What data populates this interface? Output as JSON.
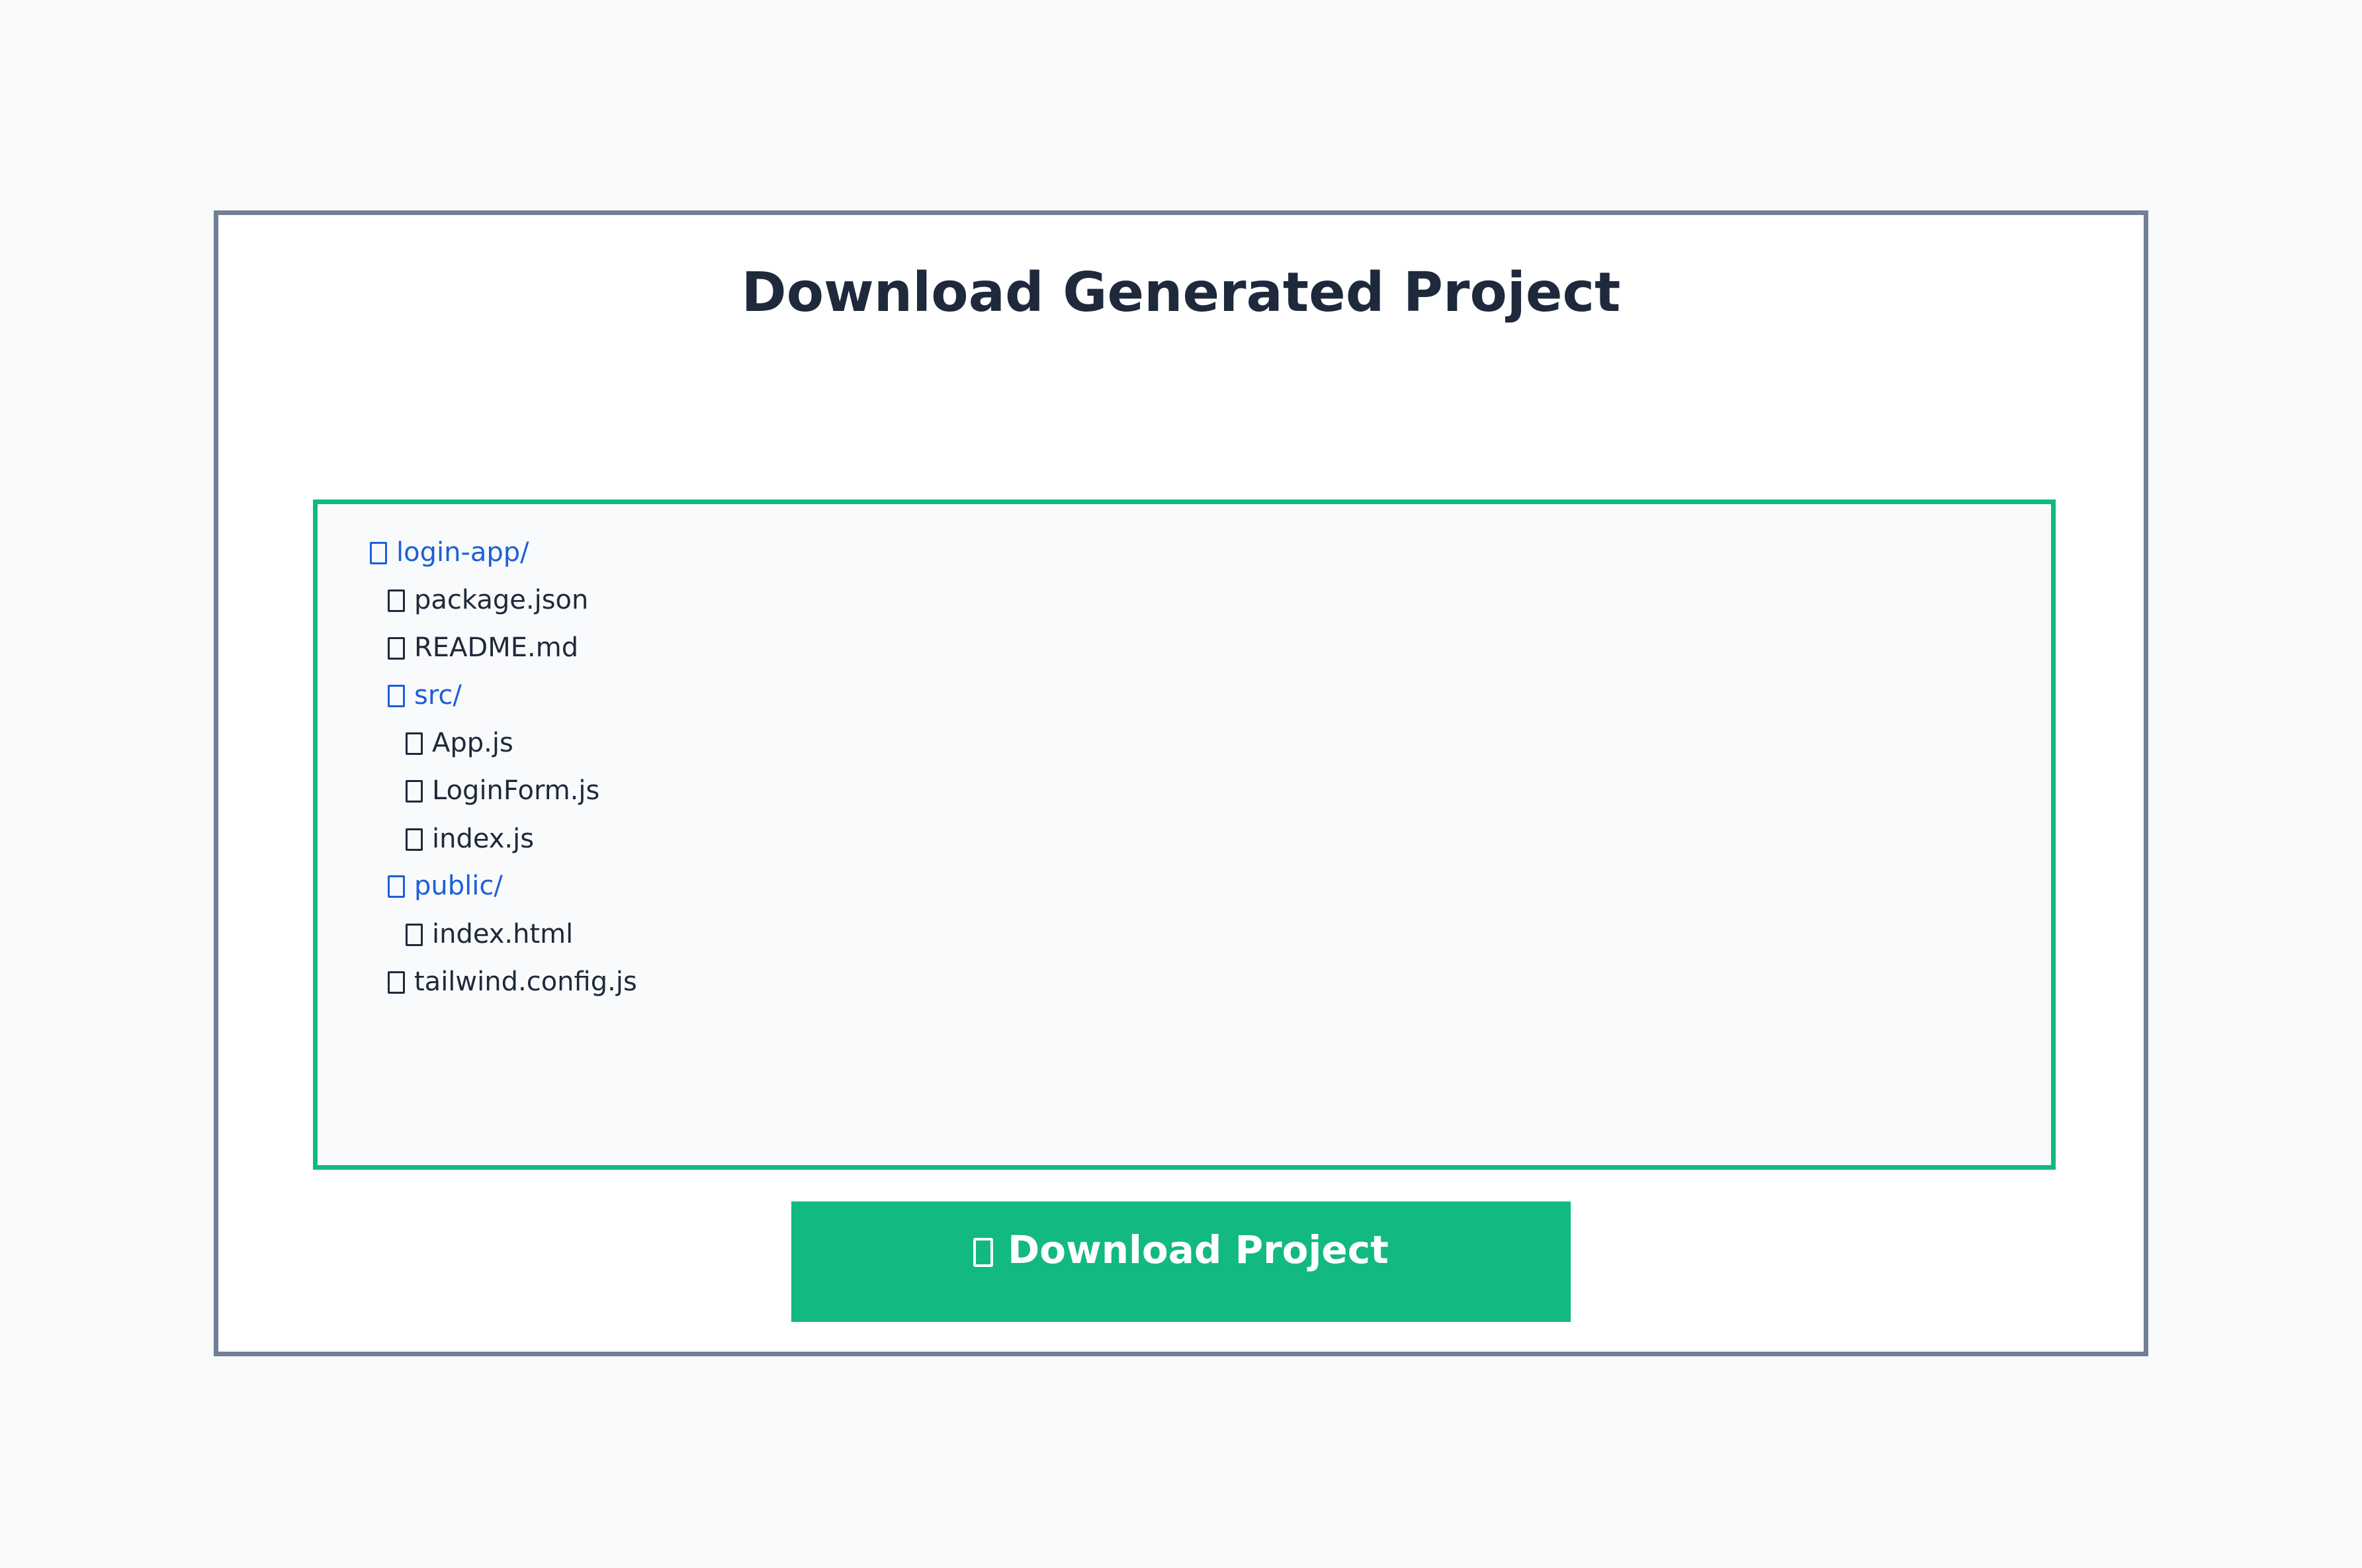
{
  "page": {
    "title": "Download Generated Project"
  },
  "file_tree": {
    "items": [
      {
        "label": "login-app/",
        "type": "folder",
        "depth": 0,
        "icon": "folder-icon"
      },
      {
        "label": "package.json",
        "type": "file",
        "depth": 1,
        "icon": "file-icon"
      },
      {
        "label": "README.md",
        "type": "file",
        "depth": 1,
        "icon": "file-icon"
      },
      {
        "label": "src/",
        "type": "folder",
        "depth": 1,
        "icon": "folder-icon"
      },
      {
        "label": "App.js",
        "type": "file",
        "depth": 2,
        "icon": "file-icon"
      },
      {
        "label": "LoginForm.js",
        "type": "file",
        "depth": 2,
        "icon": "file-icon"
      },
      {
        "label": "index.js",
        "type": "file",
        "depth": 2,
        "icon": "file-icon"
      },
      {
        "label": "public/",
        "type": "folder",
        "depth": 1,
        "icon": "folder-icon"
      },
      {
        "label": "index.html",
        "type": "file",
        "depth": 2,
        "icon": "file-icon"
      },
      {
        "label": "tailwind.config.js",
        "type": "file",
        "depth": 1,
        "icon": "file-icon"
      }
    ]
  },
  "download_button": {
    "label": "Download Project",
    "icon": "download-icon"
  },
  "colors": {
    "accent": "#10b981",
    "folder_text": "#1d5fd6",
    "file_text": "#1e293b",
    "panel_border": "#718096",
    "background": "#f8fafc"
  }
}
